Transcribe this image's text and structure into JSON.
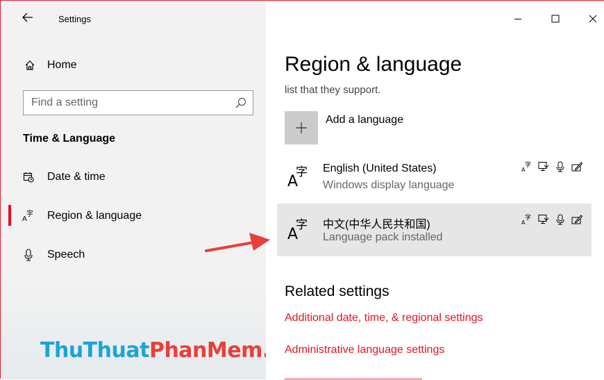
{
  "window": {
    "title": "Settings",
    "accent": "#e81123"
  },
  "sidebar": {
    "home_label": "Home",
    "search": {
      "placeholder": "Find a setting",
      "value": ""
    },
    "section_title": "Time & Language",
    "items": [
      {
        "label": "Date & time",
        "icon": "calendar-clock-icon",
        "active": false
      },
      {
        "label": "Region & language",
        "icon": "language-icon",
        "active": true
      },
      {
        "label": "Speech",
        "icon": "microphone-icon",
        "active": false
      }
    ]
  },
  "watermark": {
    "part1": "ThuThuat",
    "part2": "PhanMem.vn",
    "color1": "#1ba3d9",
    "color2": "#e8403c"
  },
  "main": {
    "title": "Region & language",
    "subtitle": "list that they support.",
    "add_language_label": "Add a language",
    "languages": [
      {
        "name": "English (United States)",
        "status": "Windows display language",
        "selected": false
      },
      {
        "name": "中文(中华人民共和国)",
        "status": "Language pack installed",
        "selected": true
      }
    ],
    "related_title": "Related settings",
    "links": [
      "Additional date, time, & regional settings",
      "Administrative language settings"
    ]
  }
}
